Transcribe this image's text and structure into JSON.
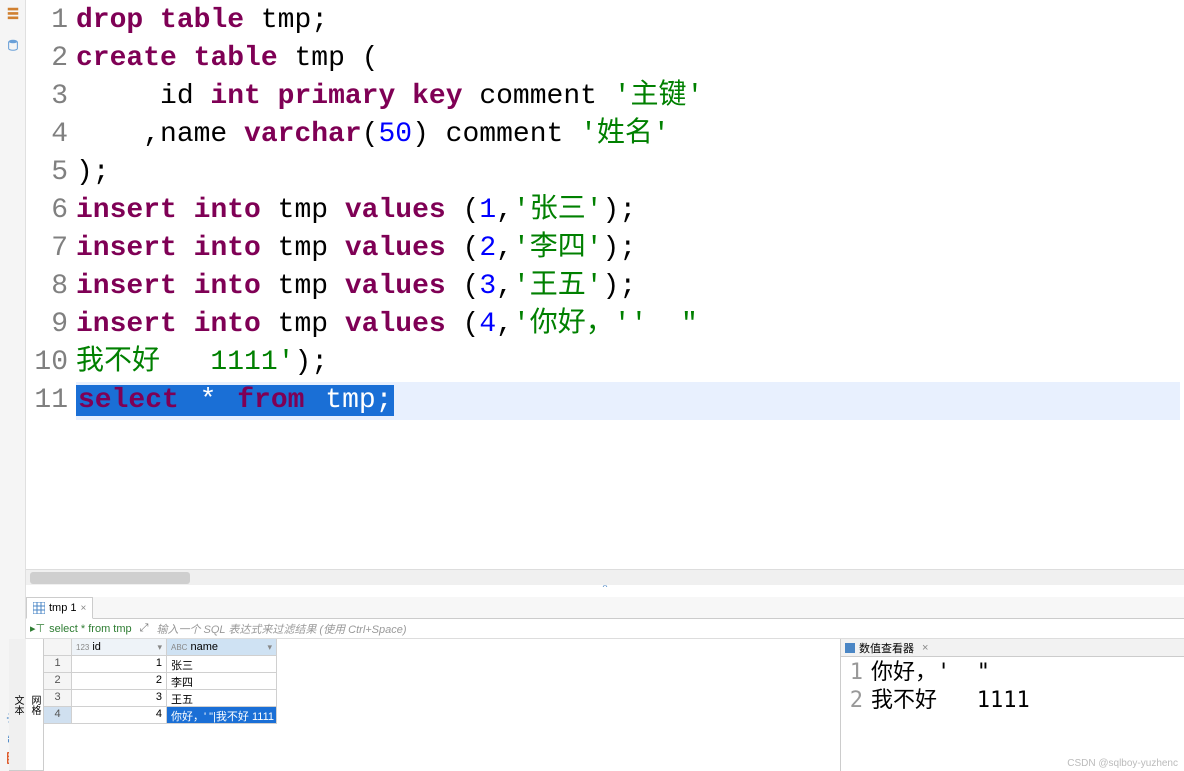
{
  "editor": {
    "lines": [
      {
        "n": "1",
        "tokens": [
          {
            "t": "drop",
            "c": "kw"
          },
          {
            "t": " "
          },
          {
            "t": "table",
            "c": "kw"
          },
          {
            "t": " tmp;",
            "c": "ident"
          }
        ]
      },
      {
        "n": "2",
        "tokens": [
          {
            "t": "create",
            "c": "kw"
          },
          {
            "t": " "
          },
          {
            "t": "table",
            "c": "kw"
          },
          {
            "t": " tmp (",
            "c": "ident"
          }
        ]
      },
      {
        "n": "3",
        "tokens": [
          {
            "t": "     id ",
            "c": "ident"
          },
          {
            "t": "int",
            "c": "type"
          },
          {
            "t": " "
          },
          {
            "t": "primary",
            "c": "kw"
          },
          {
            "t": " "
          },
          {
            "t": "key",
            "c": "kw"
          },
          {
            "t": " comment ",
            "c": "ident"
          },
          {
            "t": "'主键'",
            "c": "str"
          }
        ]
      },
      {
        "n": "4",
        "tokens": [
          {
            "t": "    ,name ",
            "c": "ident"
          },
          {
            "t": "varchar",
            "c": "type"
          },
          {
            "t": "(",
            "c": "punct"
          },
          {
            "t": "50",
            "c": "num"
          },
          {
            "t": ") comment ",
            "c": "ident"
          },
          {
            "t": "'姓名'",
            "c": "str"
          }
        ]
      },
      {
        "n": "5",
        "tokens": [
          {
            "t": ");",
            "c": "ident"
          }
        ]
      },
      {
        "n": "6",
        "tokens": [
          {
            "t": "insert",
            "c": "kw"
          },
          {
            "t": " "
          },
          {
            "t": "into",
            "c": "kw"
          },
          {
            "t": " tmp ",
            "c": "ident"
          },
          {
            "t": "values",
            "c": "kw"
          },
          {
            "t": " (",
            "c": "punct"
          },
          {
            "t": "1",
            "c": "num"
          },
          {
            "t": ",",
            "c": "punct"
          },
          {
            "t": "'张三'",
            "c": "str"
          },
          {
            "t": ");",
            "c": "punct"
          }
        ]
      },
      {
        "n": "7",
        "tokens": [
          {
            "t": "insert",
            "c": "kw"
          },
          {
            "t": " "
          },
          {
            "t": "into",
            "c": "kw"
          },
          {
            "t": " tmp ",
            "c": "ident"
          },
          {
            "t": "values",
            "c": "kw"
          },
          {
            "t": " (",
            "c": "punct"
          },
          {
            "t": "2",
            "c": "num"
          },
          {
            "t": ",",
            "c": "punct"
          },
          {
            "t": "'李四'",
            "c": "str"
          },
          {
            "t": ");",
            "c": "punct"
          }
        ]
      },
      {
        "n": "8",
        "tokens": [
          {
            "t": "insert",
            "c": "kw"
          },
          {
            "t": " "
          },
          {
            "t": "into",
            "c": "kw"
          },
          {
            "t": " tmp ",
            "c": "ident"
          },
          {
            "t": "values",
            "c": "kw"
          },
          {
            "t": " (",
            "c": "punct"
          },
          {
            "t": "3",
            "c": "num"
          },
          {
            "t": ",",
            "c": "punct"
          },
          {
            "t": "'王五'",
            "c": "str"
          },
          {
            "t": ");",
            "c": "punct"
          }
        ]
      },
      {
        "n": "9",
        "tokens": [
          {
            "t": "insert",
            "c": "kw"
          },
          {
            "t": " "
          },
          {
            "t": "into",
            "c": "kw"
          },
          {
            "t": " tmp ",
            "c": "ident"
          },
          {
            "t": "values",
            "c": "kw"
          },
          {
            "t": " (",
            "c": "punct"
          },
          {
            "t": "4",
            "c": "num"
          },
          {
            "t": ",",
            "c": "punct"
          },
          {
            "t": "'你好，''  \"",
            "c": "str"
          }
        ]
      },
      {
        "n": "10",
        "tokens": [
          {
            "t": "我不好   1111'",
            "c": "str"
          },
          {
            "t": ");",
            "c": "punct"
          }
        ]
      },
      {
        "n": "11",
        "hl": true,
        "tokens": [
          {
            "t": "select",
            "c": "kw",
            "sel": true
          },
          {
            "t": " * ",
            "sel": true
          },
          {
            "t": "from",
            "c": "kw",
            "sel": true
          },
          {
            "t": " tmp;",
            "sel": true
          }
        ]
      }
    ]
  },
  "tab": {
    "label": "tmp 1",
    "close": "×"
  },
  "filter": {
    "runlabel": "select * from tmp",
    "hint": "输入一个 SQL 表达式来过滤结果 (使用 Ctrl+Space)"
  },
  "sidetabs": {
    "grid": "网格",
    "text": "文本"
  },
  "grid": {
    "cols": {
      "id": {
        "pre": "123",
        "label": "id"
      },
      "name": {
        "pre": "ABC",
        "label": "name"
      }
    },
    "rows": [
      {
        "n": "1",
        "id": "1",
        "name": "张三"
      },
      {
        "n": "2",
        "id": "2",
        "name": "李四"
      },
      {
        "n": "3",
        "id": "3",
        "name": "王五"
      },
      {
        "n": "4",
        "id": "4",
        "name": "你好，' \"|我不好 1111",
        "selected": true
      }
    ]
  },
  "valuepanel": {
    "title": "数值查看器",
    "lines": [
      {
        "n": "1",
        "t": "你好，'  \""
      },
      {
        "n": "2",
        "t": "我不好   1111"
      }
    ]
  },
  "watermark": "CSDN @sqlboy-yuzhenc"
}
